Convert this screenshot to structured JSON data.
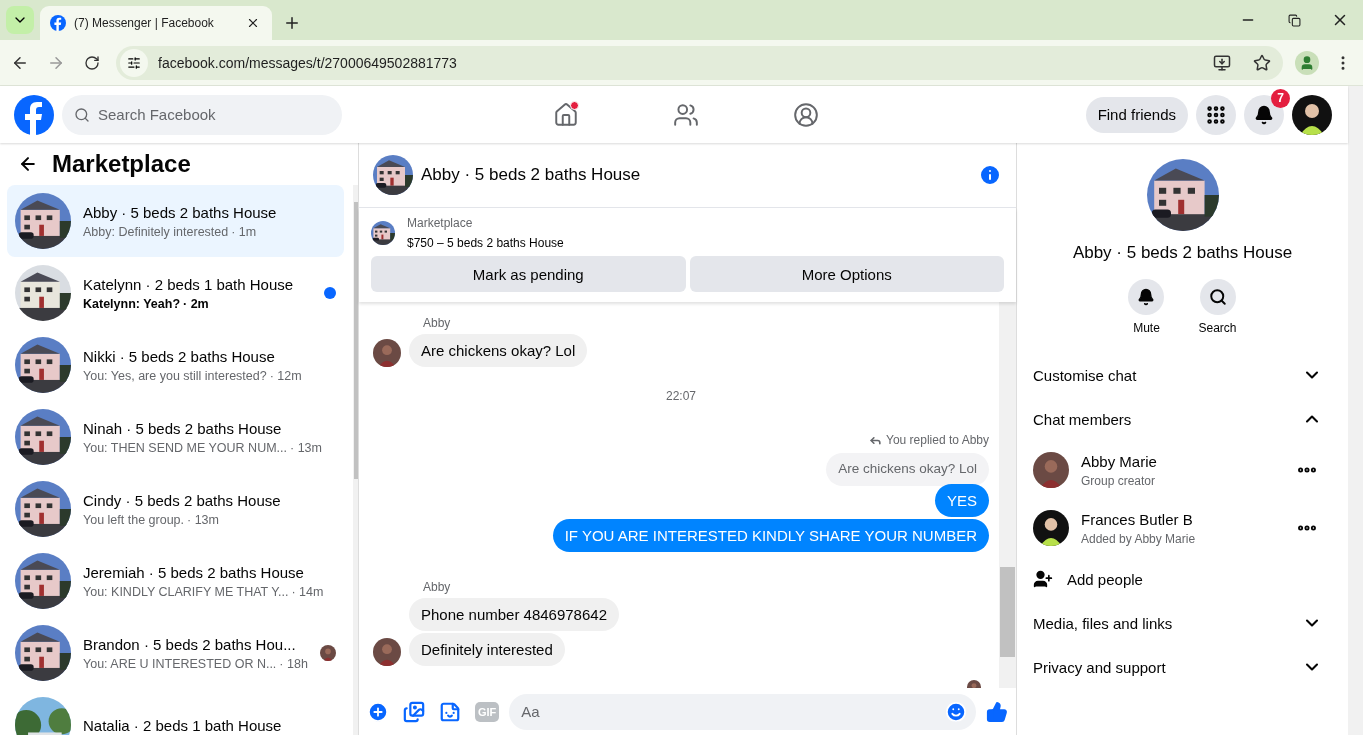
{
  "browser": {
    "tab": {
      "title": "(7) Messenger | Facebook"
    },
    "url": "facebook.com/messages/t/27000649502881773"
  },
  "header": {
    "search": {
      "placeholder": "Search Facebook"
    },
    "nav": [
      {
        "kind": "home",
        "notification": true
      },
      {
        "kind": "friends",
        "notification": false
      },
      {
        "kind": "groups",
        "notification": false
      }
    ],
    "find_friends": "Find friends",
    "notifications_badge": "7"
  },
  "sidebar": {
    "title": "Marketplace",
    "conversations": [
      {
        "title": "Abby · 5 beds 2 baths House",
        "preview": "Abby: Definitely interested",
        "time": "· 1m",
        "selected": true,
        "unread": false,
        "seen": false
      },
      {
        "title": "Katelynn · 2 beds 1 bath House",
        "preview": "Katelynn: Yeah?",
        "time": "· 2m",
        "selected": false,
        "unread": true,
        "seen": false
      },
      {
        "title": "Nikki · 5 beds 2 baths House",
        "preview": "You: Yes, are you still interested?",
        "time": "· 12m",
        "selected": false,
        "unread": false,
        "seen": false
      },
      {
        "title": "Ninah · 5 beds 2 baths House",
        "preview": "You: THEN SEND ME YOUR NUM...",
        "time": "· 13m",
        "selected": false,
        "unread": false,
        "seen": false
      },
      {
        "title": "Cindy · 5 beds 2 baths House",
        "preview": "You left the group.",
        "time": "· 13m",
        "selected": false,
        "unread": false,
        "seen": false
      },
      {
        "title": "Jeremiah · 5 beds 2 baths House",
        "preview": "You: KINDLY CLARIFY ME THAT Y...",
        "time": "· 14m",
        "selected": false,
        "unread": false,
        "seen": false
      },
      {
        "title": "Brandon · 5 beds 2 baths Hou...",
        "preview": "You: ARE U INTERESTED OR N...",
        "time": "· 18h",
        "selected": false,
        "unread": false,
        "seen": true
      },
      {
        "title": "Natalia · 2 beds 1 bath House",
        "selected": false,
        "unread": false,
        "seen": false
      }
    ]
  },
  "chat": {
    "title": "Abby · 5 beds 2 baths House",
    "listing": {
      "label": "Marketplace",
      "item": "$750 – 5 beds 2 baths House"
    },
    "actions": [
      "Mark as pending",
      "More Options"
    ],
    "messages": [
      {
        "kind": "sender",
        "text": "Abby"
      },
      {
        "kind": "incoming",
        "text": "Are chickens okay? Lol",
        "avatar": true
      },
      {
        "kind": "time",
        "text": "22:07"
      },
      {
        "kind": "reply_note",
        "text": "You replied to Abby"
      },
      {
        "kind": "quoted",
        "text": "Are chickens okay? Lol"
      },
      {
        "kind": "outgoing",
        "text": "YES"
      },
      {
        "kind": "outgoing",
        "text": "IF YOU ARE INTERESTED KINDLY SHARE YOUR NUMBER"
      },
      {
        "kind": "sender",
        "text": "Abby"
      },
      {
        "kind": "incoming",
        "text": "Phone number 4846978642",
        "avatar": false
      },
      {
        "kind": "incoming",
        "text": "Definitely interested",
        "avatar": true
      },
      {
        "kind": "seen"
      }
    ],
    "composer": {
      "placeholder": "Aa",
      "gif": "GIF"
    }
  },
  "details": {
    "title": "Abby · 5 beds 2 baths House",
    "actions": [
      {
        "kind": "mute",
        "label": "Mute"
      },
      {
        "kind": "search",
        "label": "Search"
      }
    ],
    "items": [
      {
        "kind": "section",
        "label": "Customise chat",
        "expanded": false
      },
      {
        "kind": "section",
        "label": "Chat members",
        "expanded": true
      },
      {
        "kind": "member",
        "name": "Abby Marie",
        "subtitle": "Group creator"
      },
      {
        "kind": "member",
        "name": "Frances Butler B",
        "subtitle": "Added by Abby Marie"
      },
      {
        "kind": "add",
        "label": "Add people"
      },
      {
        "kind": "section",
        "label": "Media, files and links",
        "expanded": false
      },
      {
        "kind": "section",
        "label": "Privacy and support",
        "expanded": false
      }
    ]
  }
}
